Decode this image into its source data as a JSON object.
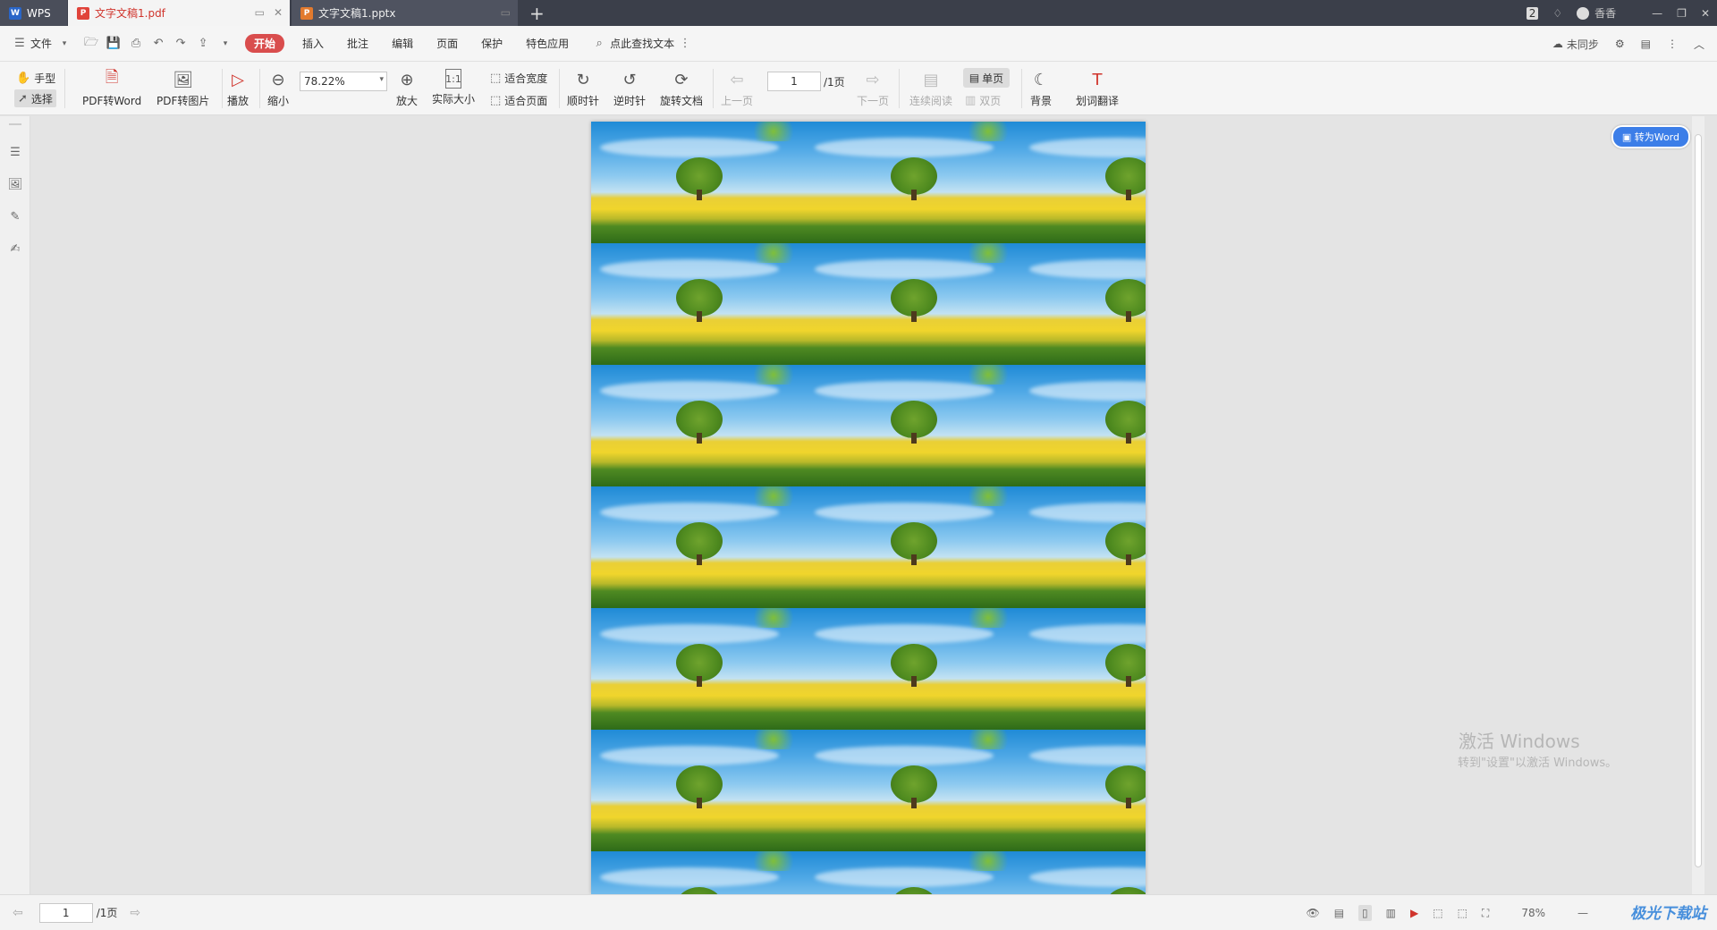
{
  "tabs": {
    "wps": "WPS",
    "pdf": "文字文稿1.pdf",
    "ppt": "文字文稿1.pptx"
  },
  "titlebar": {
    "badge": "2",
    "user": "香香"
  },
  "menu": {
    "file": "文件",
    "start": "开始",
    "items": [
      "插入",
      "批注",
      "编辑",
      "页面",
      "保护",
      "特色应用"
    ],
    "search": "点此查找文本",
    "sync": "未同步"
  },
  "ribbon": {
    "hand": "手型",
    "select": "选择",
    "pdf_to_word": "PDF转Word",
    "pdf_to_image": "PDF转图片",
    "play": "播放",
    "zoom_out": "缩小",
    "zoom_value": "78.22%",
    "zoom_in": "放大",
    "actual_size": "实际大小",
    "fit_width": "适合宽度",
    "fit_page": "适合页面",
    "clockwise": "顺时针",
    "counter_clockwise": "逆时针",
    "rotate_doc": "旋转文档",
    "prev_page": "上一页",
    "page_value": "1",
    "page_total": "/1页",
    "next_page": "下一页",
    "continuous": "连续阅读",
    "single": "单页",
    "double": "双页",
    "background": "背景",
    "translate": "划词翻译"
  },
  "doc": {
    "to_word": "转为Word",
    "tiles_rows": 7,
    "tiles_cols": 3
  },
  "watermark": {
    "line1": "激活 Windows",
    "line2": "转到\"设置\"以激活 Windows。"
  },
  "statusbar": {
    "page_value": "1",
    "page_total": "/1页",
    "zoom": "78%",
    "logo": "极光下载站"
  }
}
